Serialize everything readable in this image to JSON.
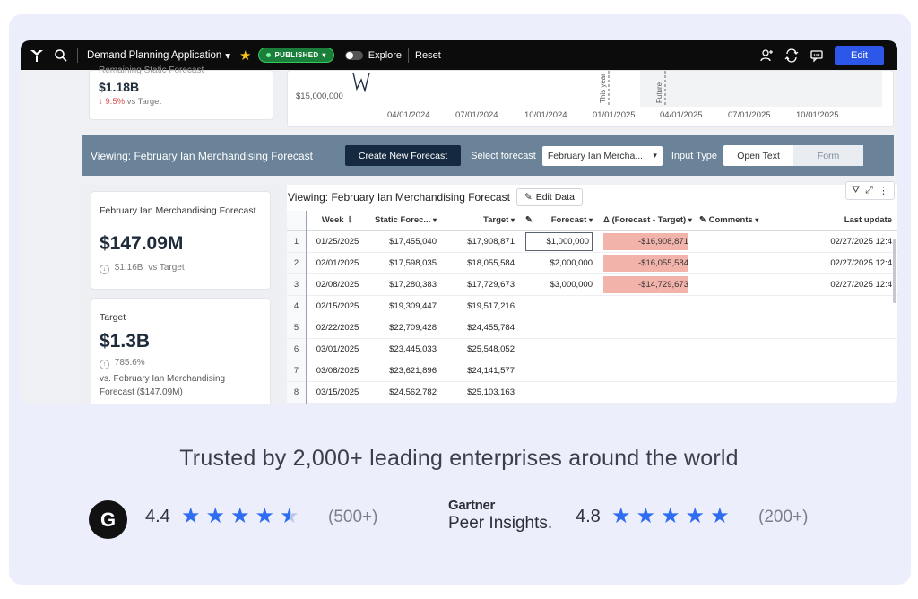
{
  "topbar": {
    "app_title": "Demand Planning Application",
    "status_badge": "PUBLISHED",
    "explore_label": "Explore",
    "reset_label": "Reset",
    "edit_label": "Edit"
  },
  "top_kpi": {
    "cut_label": "Remaining Static Forecast",
    "value": "$1.18B",
    "delta_pct": "9.5%",
    "delta_suffix": "vs Target"
  },
  "top_chart": {
    "y_label": "$15,000,000",
    "x_ticks": [
      "04/01/2024",
      "07/01/2024",
      "10/01/2024",
      "01/01/2025",
      "04/01/2025",
      "07/01/2025",
      "10/01/2025"
    ],
    "marker_this_year": "This year",
    "marker_future": "Future"
  },
  "banner": {
    "title": "Viewing: February Ian Merchandising Forecast",
    "create_button": "Create New Forecast",
    "select_label": "Select forecast",
    "select_value": "February Ian Mercha...",
    "input_type_label": "Input Type",
    "input_options": [
      "Open Text",
      "Form"
    ]
  },
  "kpi_forecast": {
    "label": "February Ian Merchandising Forecast",
    "value": "$147.09M",
    "delta": "$1.16B",
    "delta_suffix": "vs Target"
  },
  "kpi_target": {
    "label": "Target",
    "value": "$1.3B",
    "delta": "785.6%",
    "vs_text": "vs. February Ian Merchandising Forecast ($147.09M)"
  },
  "table": {
    "title": "Viewing: February Ian Merchandising Forecast",
    "edit_button": "Edit Data",
    "columns": [
      "",
      "Week",
      "Static Forec...",
      "Target",
      "Forecast",
      "Δ (Forecast - Target)",
      "Comments",
      "Last update"
    ],
    "rows": [
      [
        "1",
        "01/25/2025",
        "$17,455,040",
        "$17,908,871",
        "$1,000,000",
        "-$16,908,871",
        "",
        "02/27/2025 12:4"
      ],
      [
        "2",
        "02/01/2025",
        "$17,598,035",
        "$18,055,584",
        "$2,000,000",
        "-$16,055,584",
        "",
        "02/27/2025 12:4"
      ],
      [
        "3",
        "02/08/2025",
        "$17,280,383",
        "$17,729,673",
        "$3,000,000",
        "-$14,729,673",
        "",
        "02/27/2025 12:4"
      ],
      [
        "4",
        "02/15/2025",
        "$19,309,447",
        "$19,517,216",
        "",
        "",
        "",
        ""
      ],
      [
        "5",
        "02/22/2025",
        "$22,709,428",
        "$24,455,784",
        "",
        "",
        "",
        ""
      ],
      [
        "6",
        "03/01/2025",
        "$23,445,033",
        "$25,548,052",
        "",
        "",
        "",
        ""
      ],
      [
        "7",
        "03/08/2025",
        "$23,621,896",
        "$24,141,577",
        "",
        "",
        "",
        ""
      ],
      [
        "8",
        "03/15/2025",
        "$24,562,782",
        "$25,103,163",
        "",
        "",
        "",
        ""
      ]
    ]
  },
  "trust": {
    "headline": "Trusted by 2,000+ leading enterprises around the world",
    "g2_rating": "4.4",
    "g2_count": "(500+)",
    "gartner_line1": "Gartner",
    "gartner_line2": "Peer Insights.",
    "gartner_rating": "4.8",
    "gartner_count": "(200+)"
  },
  "colors": {
    "accent": "#2c57e8",
    "banner": "#6a8398",
    "negative_cell": "#f2b3aa",
    "star": "#2f6df0"
  }
}
